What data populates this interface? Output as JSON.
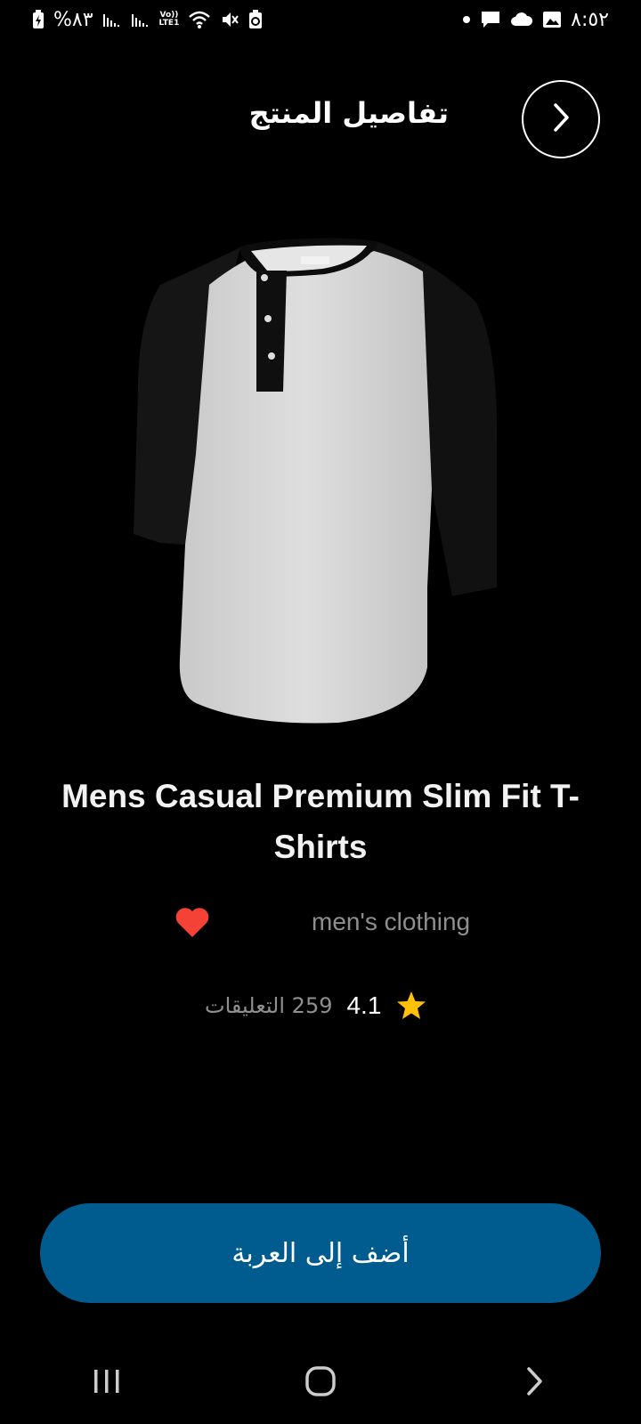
{
  "status_bar": {
    "battery_text": "%٨٣",
    "network_label": "LTE1",
    "volte_label": "Vo))",
    "time": "٨:٥٢"
  },
  "header": {
    "title": "تفاصيل المنتج"
  },
  "product": {
    "title": "Mens Casual Premium Slim Fit T-Shirts",
    "category": "men's clothing",
    "rating": "4.1",
    "reviews": "259 التعليقات",
    "favorited": true
  },
  "actions": {
    "add_to_cart_label": "أضف إلى العربة"
  },
  "colors": {
    "background": "#000000",
    "accent_button": "#005b8f",
    "heart": "#f44336",
    "star": "#ffc107",
    "muted_text": "#8f8f8f"
  }
}
